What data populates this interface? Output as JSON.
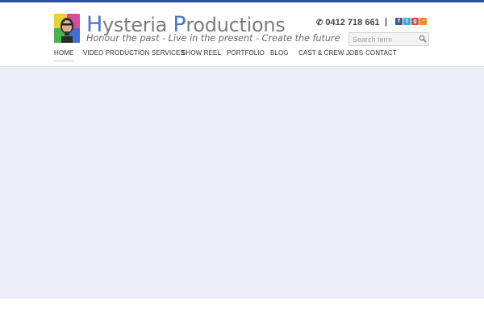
{
  "header": {
    "brand_first_initial": "H",
    "brand_first_rest": "ysteria ",
    "brand_second_initial": "P",
    "brand_second_rest": "roductions",
    "tagline": "Honour the past - Live in the present - Create the future",
    "phone": "0412 718 661",
    "separator": "|",
    "social_icons": [
      "facebook-icon",
      "twitter-icon",
      "google-plus-icon",
      "rss-icon"
    ]
  },
  "search": {
    "placeholder": "Search term",
    "value": ""
  },
  "nav": {
    "items": [
      {
        "label": "HOME",
        "active": true
      },
      {
        "label": "VIDEO PRODUCTION SERVICES"
      },
      {
        "label": "SHOW REEL"
      },
      {
        "label": "PORTFOLIO"
      },
      {
        "label": "BLOG"
      },
      {
        "label": "CAST & CREW JOBS"
      },
      {
        "label": "CONTACT"
      }
    ]
  },
  "colors": {
    "accent": "#2d4fa3",
    "brand_initial": "#4a76c9",
    "main_background": "#eeeef8"
  }
}
